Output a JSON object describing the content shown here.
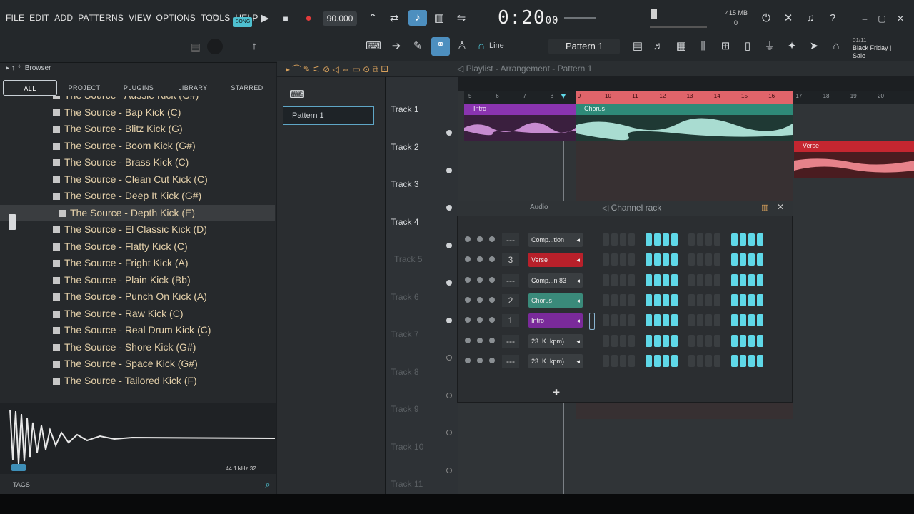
{
  "menu": [
    "FILE",
    "EDIT",
    "ADD",
    "PATTERNS",
    "VIEW",
    "OPTIONS",
    "TOOLS",
    "HELP"
  ],
  "transport": {
    "tempo": "90.000",
    "time": "0:20",
    "time_small": "00",
    "mode_label": "Line",
    "pattern_label": "Pattern 1",
    "memory": "415 MB",
    "cpu_val": "0",
    "news": "Black Friday | Sale",
    "news_date": "01/11"
  },
  "browser": {
    "title": "Browser",
    "tabs": [
      "ALL",
      "PROJECT",
      "PLUGINS",
      "LIBRARY",
      "STARRED"
    ],
    "items": [
      "The Source - Aussie Kick (G#)",
      "The Source - Bap Kick (C)",
      "The Source - Blitz Kick (G)",
      "The Source - Boom Kick (G#)",
      "The Source - Brass Kick (C)",
      "The Source - Clean Cut Kick (C)",
      "The Source - Deep It Kick (G#)",
      "The Source - Depth Kick (E)",
      "The Source - El Classic Kick (D)",
      "The Source - Flatty Kick (C)",
      "The Source - Fright Kick (A)",
      "The Source - Plain Kick (Bb)",
      "The Source - Punch On Kick (A)",
      "The Source - Raw Kick (C)",
      "The Source - Real Drum Kick (C)",
      "The Source - Shore Kick (G#)",
      "The Source - Space Kick (G#)",
      "The Source - Tailored Kick (F)"
    ],
    "selected_index": 7,
    "sample_info": "44.1 kHz 32",
    "tags_label": "TAGS"
  },
  "playlist": {
    "title": "Playlist - Arrangement - Pattern 1",
    "pattern_item": "Pattern 1",
    "tracks": [
      "Track 1",
      "Track 2",
      "Track 3",
      "Track 4",
      "Track 5",
      "Track 6",
      "Track 7",
      "Track 8",
      "Track 9",
      "Track 10",
      "Track 11"
    ],
    "bar_numbers": [
      "5",
      "6",
      "7",
      "8",
      "9",
      "10",
      "11",
      "12",
      "13",
      "14",
      "15",
      "16",
      "17",
      "18",
      "19",
      "20"
    ],
    "clips": {
      "intro": "Intro",
      "chorus": "Chorus",
      "verse": "Verse"
    }
  },
  "channel_rack": {
    "title": "Channel rack",
    "group": "Audio",
    "channels": [
      {
        "num": "---",
        "name": "Comp...tion",
        "color": "#3a3e41"
      },
      {
        "num": "3",
        "name": "Verse",
        "color": "#b8202a"
      },
      {
        "num": "---",
        "name": "Comp...n 83",
        "color": "#3a3e41"
      },
      {
        "num": "2",
        "name": "Chorus",
        "color": "#3a8a7a"
      },
      {
        "num": "1",
        "name": "Intro",
        "color": "#7a2a9a"
      },
      {
        "num": "---",
        "name": "23. K..kpm)",
        "color": "#3a3e41"
      },
      {
        "num": "---",
        "name": "23. K..kpm)",
        "color": "#3a3e41"
      }
    ],
    "steps": [
      0,
      0,
      0,
      0,
      1,
      1,
      1,
      1,
      0,
      0,
      0,
      0,
      1,
      1,
      1,
      1
    ]
  },
  "colors": {
    "accent": "#5fd8e8",
    "loop": "#e0646a",
    "intro": "#8a34b0",
    "chorus": "#2e8a78",
    "verse": "#c42630"
  }
}
